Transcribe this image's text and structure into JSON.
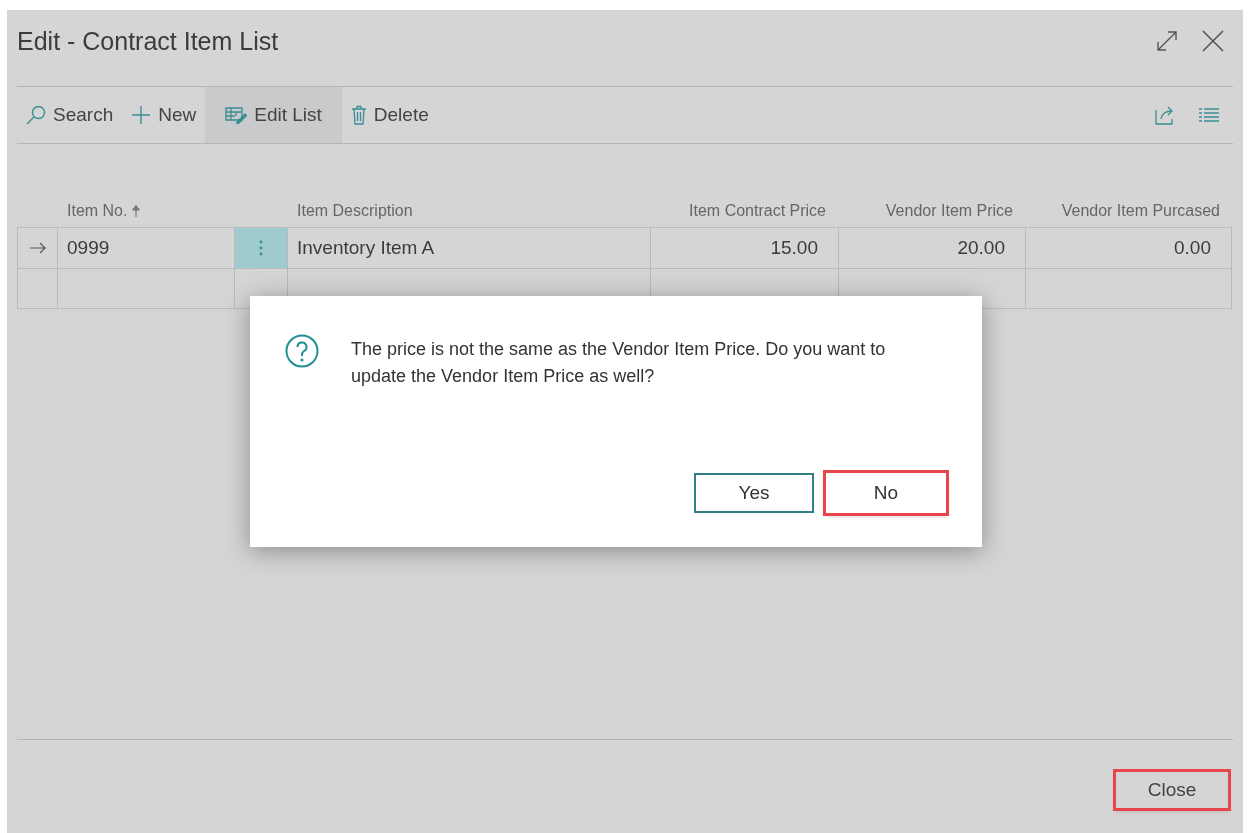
{
  "window": {
    "title": "Edit - Contract Item List"
  },
  "toolbar": {
    "actions": [
      {
        "label": "Search",
        "active": false
      },
      {
        "label": "New",
        "active": false
      },
      {
        "label": "Edit List",
        "active": true
      },
      {
        "label": "Delete",
        "active": false
      }
    ]
  },
  "table": {
    "columns": [
      {
        "label": "Item No.",
        "sorted": true
      },
      {
        "label": "Item Description",
        "sorted": false
      },
      {
        "label": "Item Contract Price",
        "sorted": false
      },
      {
        "label": "Vendor Item Price",
        "sorted": false
      },
      {
        "label": "Vendor Item Purcased",
        "sorted": false
      }
    ],
    "rows": [
      {
        "selected": true,
        "cells": [
          "0999",
          "Inventory Item A",
          "15.00",
          "20.00",
          "0.00"
        ]
      },
      {
        "selected": false,
        "cells": []
      }
    ]
  },
  "dialog": {
    "message": "The price is not the same as the Vendor Item Price. Do you want to update the Vendor Item Price as well?",
    "buttons": [
      {
        "label": "Yes",
        "kind": "outline",
        "highlighted": false
      },
      {
        "label": "No",
        "kind": "plain",
        "highlighted": true
      }
    ]
  },
  "footer": {
    "buttons": [
      {
        "label": "Close",
        "highlighted": true
      }
    ]
  }
}
